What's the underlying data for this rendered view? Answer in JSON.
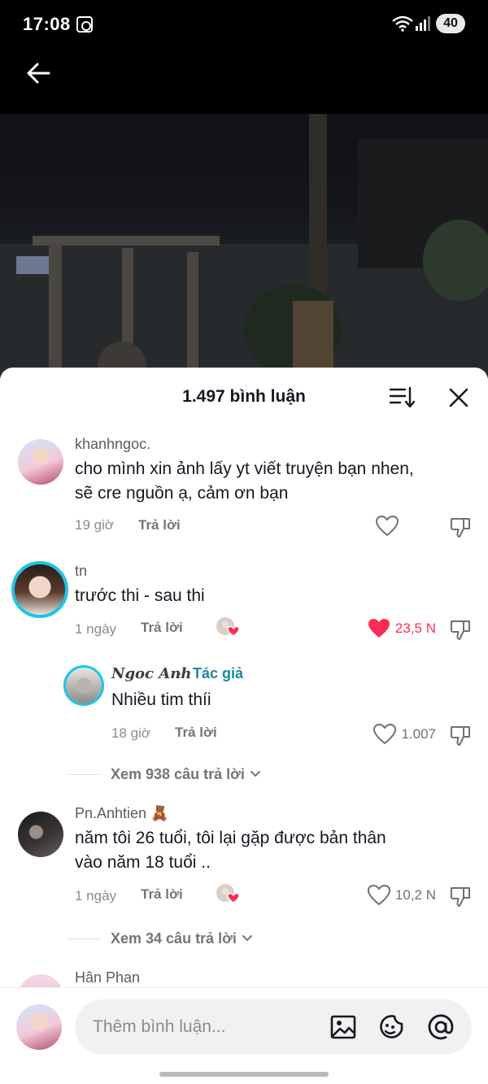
{
  "status_bar": {
    "time": "17:08",
    "battery": "40"
  },
  "comments_header": {
    "title": "1.497 bình luận"
  },
  "comments": [
    {
      "username": "khanhngoc.",
      "lines": [
        "cho mình xin ảnh lấy yt viết truyện bạn nhen,",
        "sẽ cre nguồn ạ, cảm ơn bạn"
      ],
      "time": "19 giờ",
      "reply_label": "Trả lời",
      "likes": ""
    },
    {
      "username": "tn",
      "lines": [
        "trước thi - sau thi"
      ],
      "time": "1 ngày",
      "reply_label": "Trả lời",
      "likes": "23,5 N",
      "liked": true
    },
    {
      "username": "Pn.Anhtien 🧸",
      "lines": [
        "năm tôi 26 tuổi, tôi lại gặp được bản thân",
        "vào năm 18 tuổi .."
      ],
      "time": "1 ngày",
      "reply_label": "Trả lời",
      "likes": "10,2 N"
    },
    {
      "username": "Hân Phan"
    }
  ],
  "reply": {
    "username": "Ngoc Anh",
    "separator": " · ",
    "author_badge": "Tác giả",
    "text": "Nhiều tim thíi",
    "time": "18 giờ",
    "reply_label": "Trả lời",
    "likes": "1.007"
  },
  "view_replies": [
    {
      "label": "Xem 938 câu trả lời"
    },
    {
      "label": "Xem 34 câu trả lời"
    }
  ],
  "input": {
    "placeholder": "Thêm bình luận..."
  },
  "icons": {
    "back": "arrow-left-icon",
    "sort": "sort-icon",
    "close": "close-icon",
    "like": "heart-icon",
    "dislike": "thumbs-down-icon",
    "image": "image-icon",
    "emoji": "emoji-icon",
    "mention": "at-icon"
  },
  "colors": {
    "liked": "#fe2c55",
    "author_badge": "#1a8a9c",
    "avatar_ring": "#20c4e6"
  }
}
